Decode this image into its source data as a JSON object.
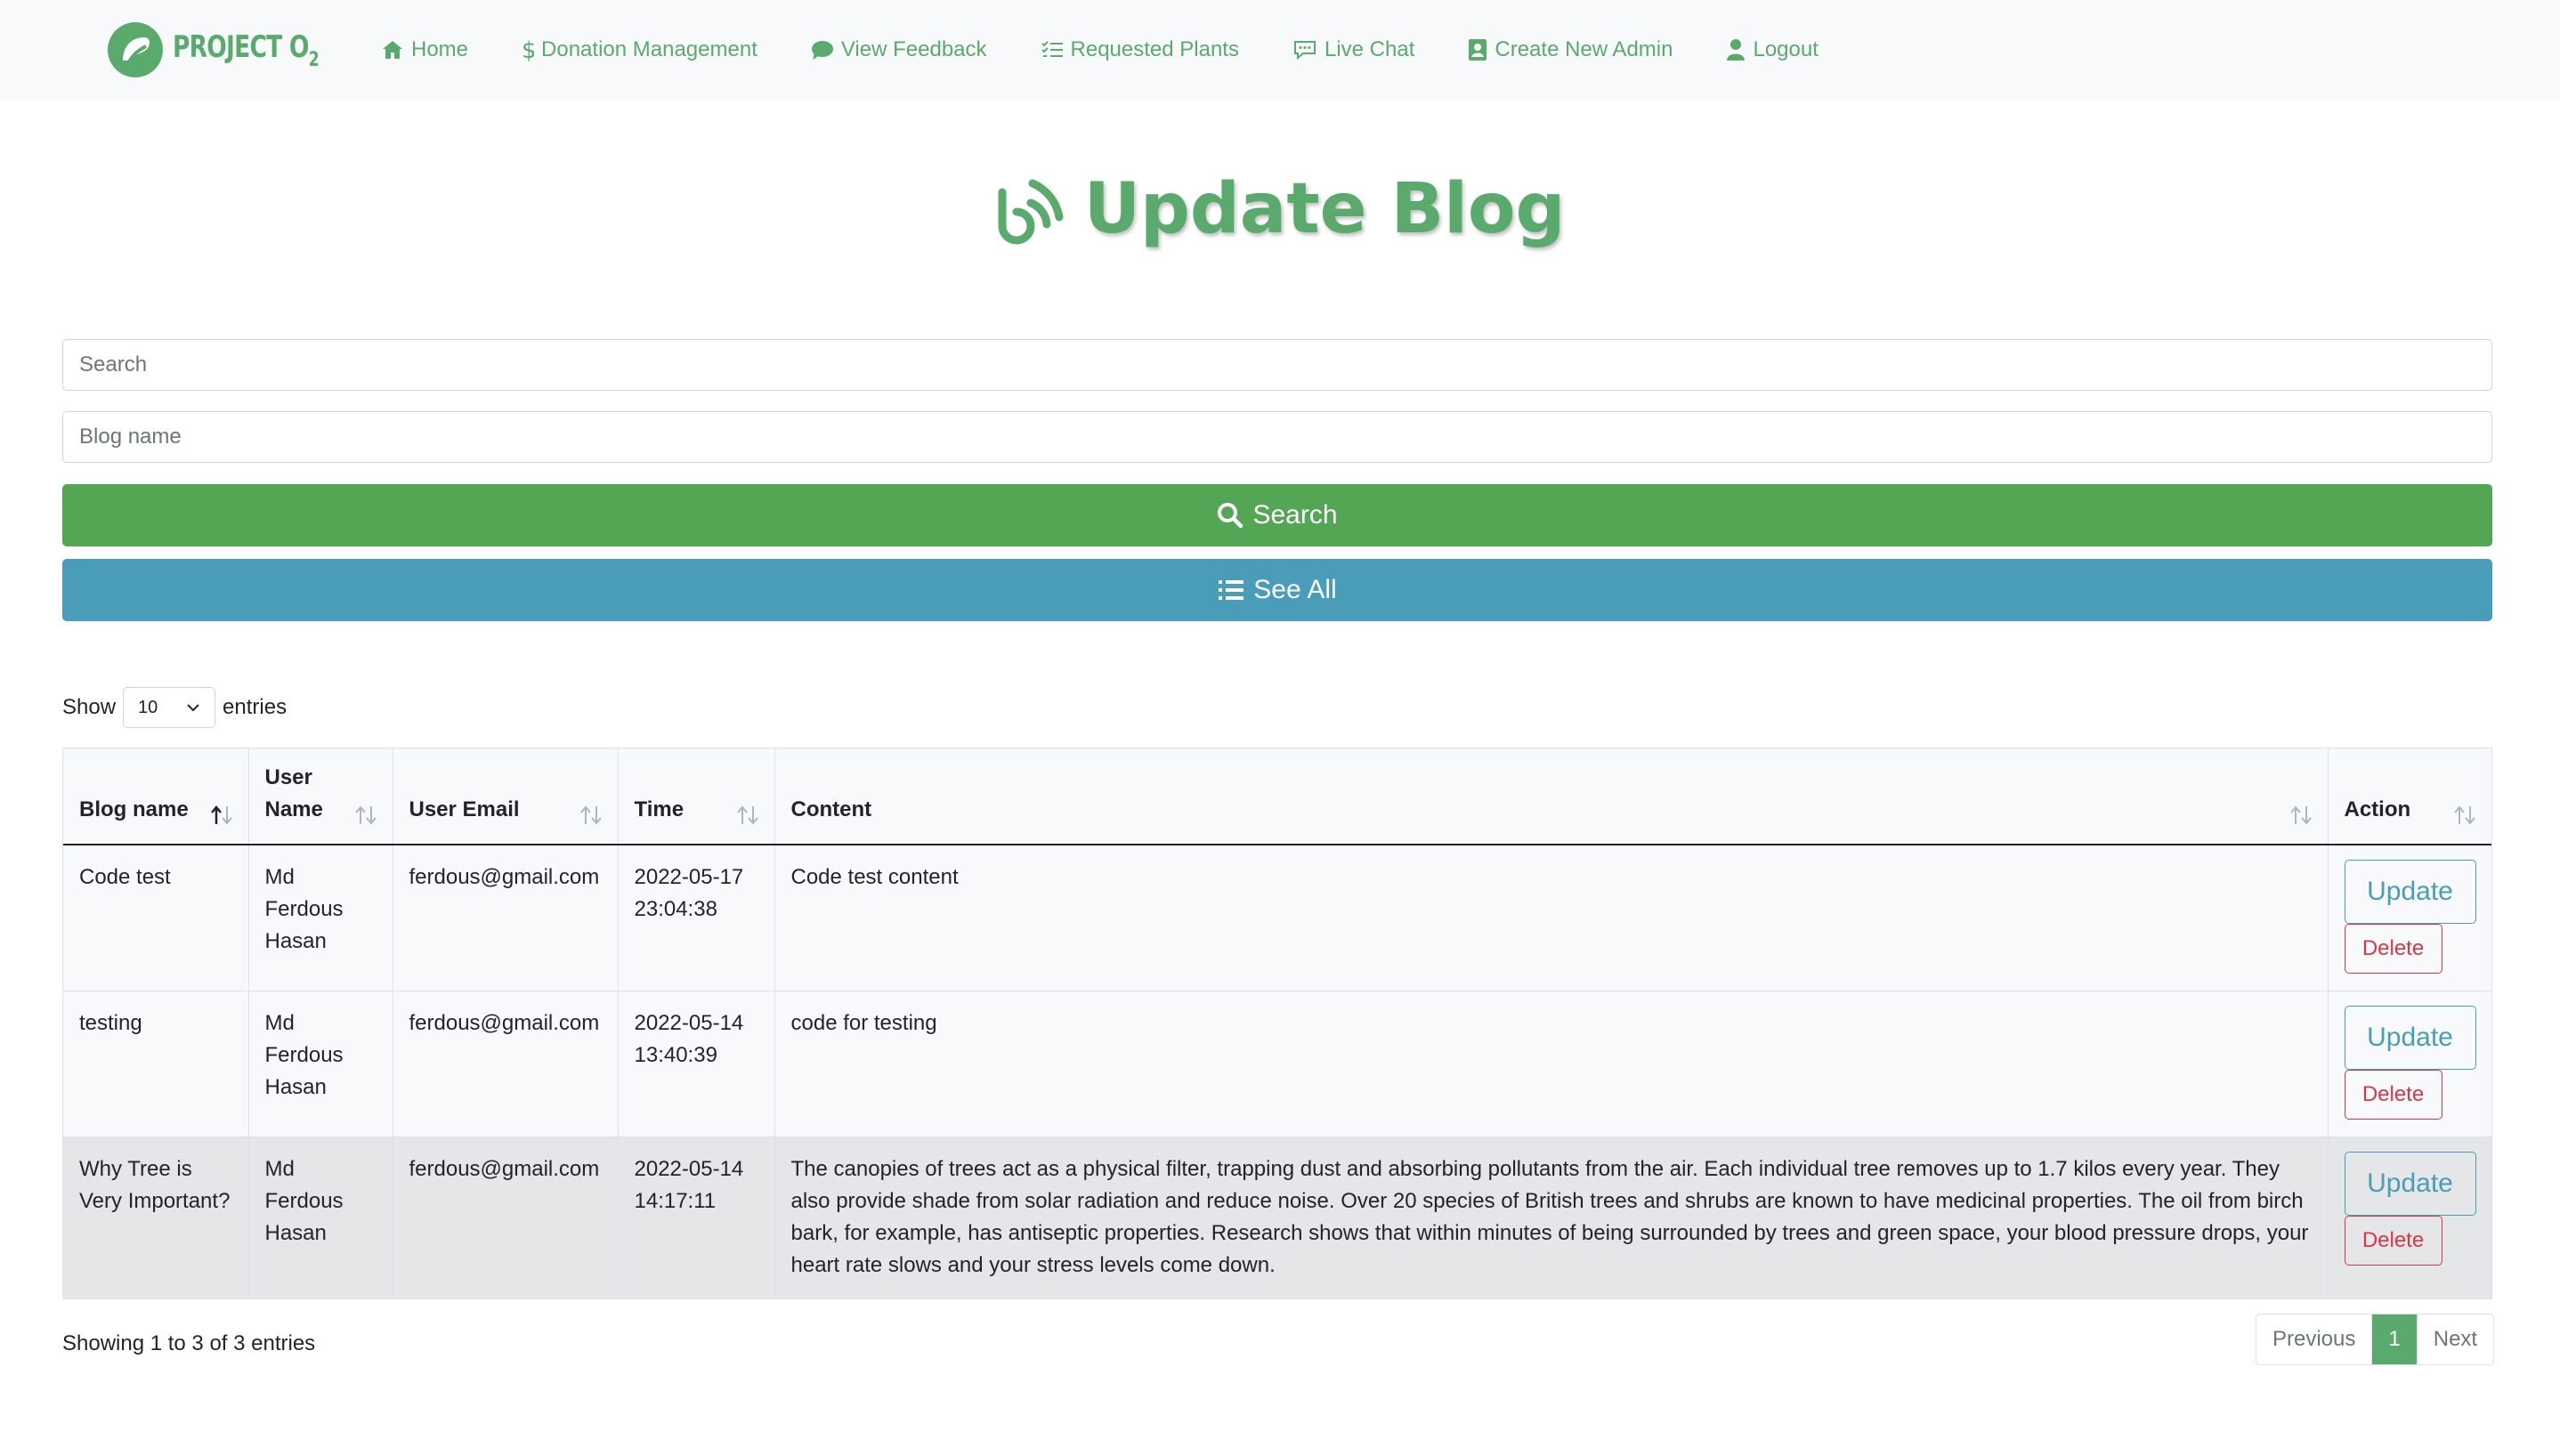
{
  "brand": {
    "name_main": "PROJECT O",
    "name_sub": "2",
    "color": "#5aaa6e"
  },
  "nav": [
    {
      "label": "Home",
      "icon": "home-icon"
    },
    {
      "label": "Donation Management",
      "icon": "dollar-icon"
    },
    {
      "label": "View Feedback",
      "icon": "comment-icon"
    },
    {
      "label": "Requested Plants",
      "icon": "list-check-icon"
    },
    {
      "label": "Live Chat",
      "icon": "chat-icon"
    },
    {
      "label": "Create New Admin",
      "icon": "id-card-icon"
    },
    {
      "label": "Logout",
      "icon": "user-icon"
    }
  ],
  "header": {
    "title": "Update Blog",
    "icon": "rss-icon"
  },
  "search": {
    "search_placeholder": "Search",
    "blog_name_placeholder": "Blog name",
    "search_button": "Search",
    "see_all_button": "See All"
  },
  "entries": {
    "show_label": "Show",
    "value": "10",
    "suffix": "entries"
  },
  "table": {
    "columns": [
      "Blog name",
      "User Name",
      "User Email",
      "Time",
      "Content",
      "Action"
    ],
    "rows": [
      {
        "blog_name": "Code test",
        "user_name": "Md Ferdous Hasan",
        "user_email": "ferdous@gmail.com",
        "time": "2022-05-17 23:04:38",
        "content": "Code test content"
      },
      {
        "blog_name": "testing",
        "user_name": "Md Ferdous Hasan",
        "user_email": "ferdous@gmail.com",
        "time": "2022-05-14 13:40:39",
        "content": "code for testing"
      },
      {
        "blog_name": "Why Tree is Very Important?",
        "user_name": "Md Ferdous Hasan",
        "user_email": "ferdous@gmail.com",
        "time": "2022-05-14 14:17:11",
        "content": "The canopies of trees act as a physical filter, trapping dust and absorbing pollutants from the air. Each individual tree removes up to 1.7 kilos every year. They also provide shade from solar radiation and reduce noise. Over 20 species of British trees and shrubs are known to have medicinal properties. The oil from birch bark, for example, has antiseptic properties. Research shows that within minutes of being surrounded by trees and green space, your blood pressure drops, your heart rate slows and your stress levels come down."
      }
    ],
    "update_label": "Update",
    "delete_label": "Delete"
  },
  "footer": {
    "info": "Showing 1 to 3 of 3 entries",
    "previous": "Previous",
    "current_page": "1",
    "next": "Next"
  },
  "colors": {
    "green": "#5aaa6e",
    "search_button": "#53a653",
    "see_all_button": "#4a9db8",
    "delete": "#dc3545"
  }
}
